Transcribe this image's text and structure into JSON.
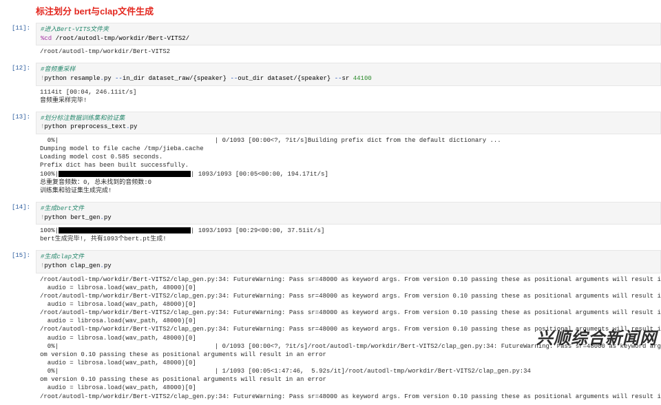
{
  "heading": "标注划分 bert与clap文件生成",
  "cells": [
    {
      "prompt": "[11]:",
      "input_html": "<span class='c-green'>#进入Bert-VITS文件夹</span>\n<span class='c-mag'>%cd</span> /root/autodl-tmp/workdir/Bert-VITS2/",
      "output": "/root/autodl-tmp/workdir/Bert-VITS2"
    },
    {
      "prompt": "[12]:",
      "input_html": "<span class='c-green'>#音频重采样</span>\n<span class='c-sep'>!</span>python resample<span class='c-blue'>.</span>py <span class='c-blue'>--</span>in_dir dataset_raw/{speaker} <span class='c-blue'>--</span>out_dir dataset/{speaker} <span class='c-blue'>--</span>sr <span class='c-num'>44100</span>",
      "output": "1114it [00:04, 246.11it/s]\n音频重采样完毕!"
    },
    {
      "prompt": "[13]:",
      "input_html": "<span class='c-green'>#划分标注数据训练集和验证集</span>\n<span class='c-sep'>!</span>python preprocess_text<span class='c-blue'>.</span>py",
      "output": "  0%|                                          | 0/1093 [00:00<?, ?it/s]Building prefix dict from the default dictionary ...\nDumping model to file cache /tmp/jieba.cache\nLoading model cost 0.585 seconds.\nPrefix dict has been built successfully.\n100%|████████████████████████████████| 1093/1093 [00:05<00:00, 194.17it/s]\n总重复音频数：0, 总未找到的音频数:0\n训练集和验证集生成完成!"
    },
    {
      "prompt": "[14]:",
      "input_html": "<span class='c-green'>#生成bert文件</span>\n<span class='c-sep'>!</span>python bert_gen<span class='c-blue'>.</span>py",
      "output": "100%|████████████████████████████████| 1093/1093 [00:29<00:00, 37.51it/s]\nbert生成完毕!, 共有1093个bert.pt生成!"
    },
    {
      "prompt": "[15]:",
      "input_html": "<span class='c-green'>#生成clap文件</span>\n<span class='c-sep'>!</span>python clap_gen<span class='c-blue'>.</span>py",
      "output": "/root/autodl-tmp/workdir/Bert-VITS2/clap_gen.py:34: FutureWarning: Pass sr=48000 as keyword args. From version 0.10 passing these as positional arguments will result in an error\n  audio = librosa.load(wav_path, 48000)[0]\n/root/autodl-tmp/workdir/Bert-VITS2/clap_gen.py:34: FutureWarning: Pass sr=48000 as keyword args. From version 0.10 passing these as positional arguments will result in an error\n  audio = librosa.load(wav_path, 48000)[0]\n/root/autodl-tmp/workdir/Bert-VITS2/clap_gen.py:34: FutureWarning: Pass sr=48000 as keyword args. From version 0.10 passing these as positional arguments will result in an error\n  audio = librosa.load(wav_path, 48000)[0]\n/root/autodl-tmp/workdir/Bert-VITS2/clap_gen.py:34: FutureWarning: Pass sr=48000 as keyword args. From version 0.10 passing these as positional arguments will result in an error\n  audio = librosa.load(wav_path, 48000)[0]\n  0%|                                          | 0/1093 [00:00<?, ?it/s]/root/autodl-tmp/workdir/Bert-VITS2/clap_gen.py:34: FutureWarning: Pass sr=48000 as keyword args. Fr\nom version 0.10 passing these as positional arguments will result in an error\n  audio = librosa.load(wav_path, 48000)[0]\n  0%|                                          | 1/1093 [00:05<1:47:46,  5.92s/it]/root/autodl-tmp/workdir/Bert-VITS2/clap_gen.py:34\nom version 0.10 passing these as positional arguments will result in an error\n  audio = librosa.load(wav_path, 48000)[0]\n/root/autodl-tmp/workdir/Bert-VITS2/clap_gen.py:34: FutureWarning: Pass sr=48000 as keyword args. From version 0.10 passing these as positional arguments will result in an error"
    }
  ],
  "watermark": "兴顺综合新闻网"
}
